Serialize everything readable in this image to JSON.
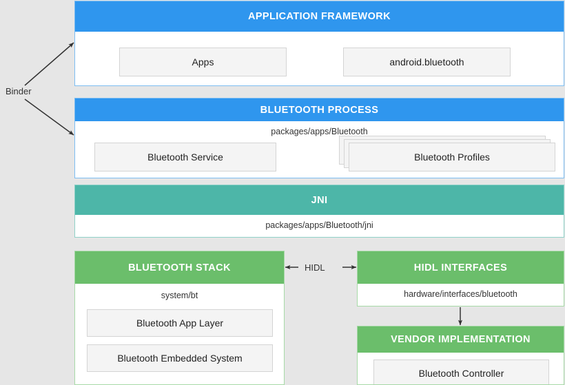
{
  "background_color": "#e6e6e6",
  "colors": {
    "blue": "#2f96ee",
    "teal": "#4db6a8",
    "green": "#6bbe6b",
    "box_fill": "#f4f4f4",
    "box_border": "#d4d4d4",
    "arrow": "#333333"
  },
  "labels": {
    "binder": "Binder",
    "hidl": "HIDL"
  },
  "sections": {
    "application_framework": {
      "title": "APPLICATION FRAMEWORK",
      "boxes": [
        {
          "label": "Apps"
        },
        {
          "label": "android.bluetooth"
        }
      ]
    },
    "bluetooth_process": {
      "title": "BLUETOOTH PROCESS",
      "path": "packages/apps/Bluetooth",
      "boxes": [
        {
          "label": "Bluetooth Service"
        },
        {
          "label": "Bluetooth Profiles"
        }
      ]
    },
    "jni": {
      "title": "JNI",
      "path": "packages/apps/Bluetooth/jni"
    },
    "bluetooth_stack": {
      "title": "BLUETOOTH STACK",
      "path": "system/bt",
      "boxes": [
        {
          "label": "Bluetooth App Layer"
        },
        {
          "label": "Bluetooth Embedded System"
        }
      ]
    },
    "hidl_interfaces": {
      "title": "HIDL INTERFACES",
      "path": "hardware/interfaces/bluetooth"
    },
    "vendor_implementation": {
      "title": "VENDOR IMPLEMENTATION",
      "boxes": [
        {
          "label": "Bluetooth Controller"
        }
      ]
    }
  }
}
